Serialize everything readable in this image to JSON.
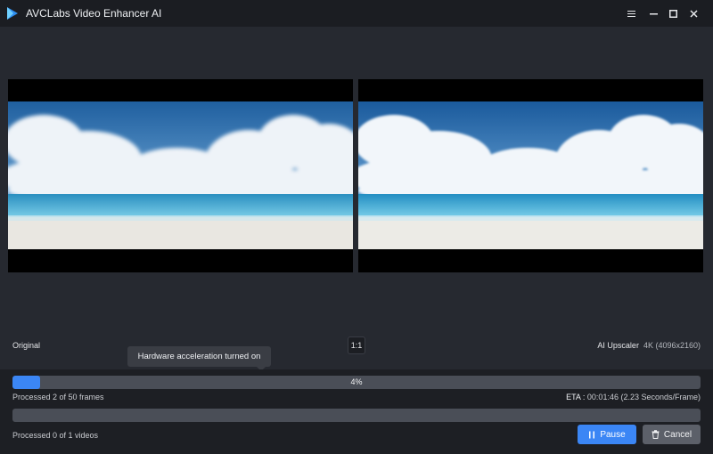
{
  "titlebar": {
    "app_name": "AVCLabs Video Enhancer AI",
    "menu_icon": "hamburger-menu-icon",
    "minimize_icon": "minimize-icon",
    "maximize_icon": "maximize-icon",
    "close_icon": "close-icon"
  },
  "preview": {
    "left_label": "Original",
    "ratio_label": "1:1",
    "right_label": "AI Upscaler",
    "right_resolution": "4K (4096x2160)"
  },
  "tooltip": {
    "text": "Hardware acceleration turned on"
  },
  "progress": {
    "percent_text": "4%",
    "fraction": 0.04,
    "frames_text": "Processed 2 of 50 frames",
    "eta_label": "ETA :",
    "eta_value": "00:01:46 (2.23 Seconds/Frame)",
    "videos_text": "Processed 0 of 1 videos"
  },
  "buttons": {
    "pause_label": "Pause",
    "cancel_label": "Cancel",
    "pause_icon": "pause-icon",
    "cancel_icon": "trash-icon"
  },
  "colors": {
    "accent": "#3b86f5",
    "background": "#24272e",
    "titlebar": "#1b1d22",
    "cancel_button": "#5c6069"
  }
}
